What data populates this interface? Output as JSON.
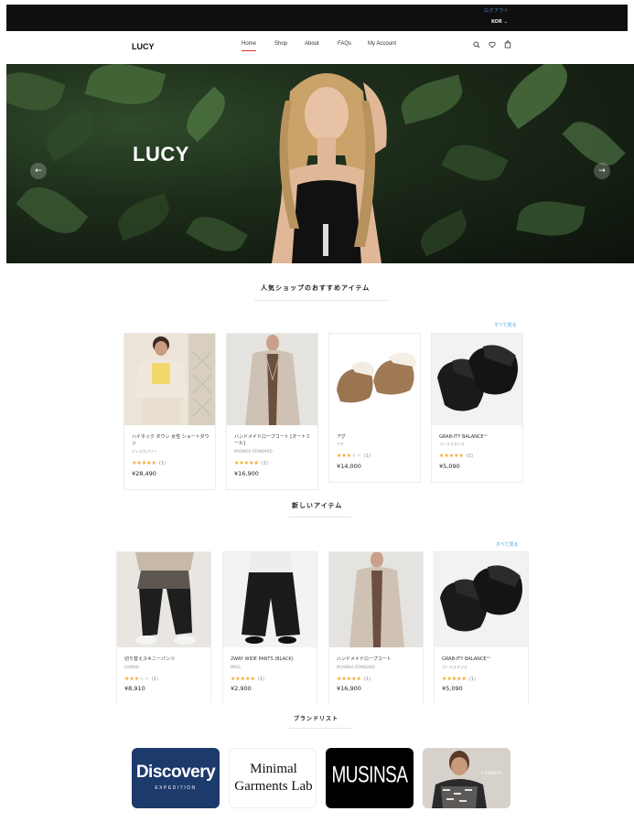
{
  "topbar": {
    "login": "ログアウト",
    "currency": "KOR ⌄"
  },
  "header": {
    "logo": "LUCY",
    "nav": [
      {
        "label": "Home",
        "active": true
      },
      {
        "label": "Shop"
      },
      {
        "label": "About"
      },
      {
        "label": "FAQs"
      },
      {
        "label": "My Account"
      }
    ],
    "icons": [
      "search-icon",
      "heart-icon",
      "bag-icon"
    ]
  },
  "hero": {
    "title": "LUCY",
    "prev": "←",
    "next": "→"
  },
  "popular": {
    "title": "人気ショップのおすすめアイテム",
    "see_all": "すべて見る",
    "items": [
      {
        "name": "ハイネック ダウン 女性 ショートダウン",
        "brand": "ディスカバリー",
        "rating": 5,
        "reviews": "(1)",
        "price": "¥28,490"
      },
      {
        "name": "ハンドメイドロープコート [オートミール]",
        "brand": "MUSINSA STANDARD",
        "rating": 5,
        "reviews": "(1)",
        "price": "¥16,900"
      },
      {
        "name": "アグ",
        "brand": "アグ",
        "rating": 3.5,
        "reviews": "(1)",
        "price": "¥14,000"
      },
      {
        "name": "GRAB-ITY BALANCE™",
        "brand": "ゴールスタジオ",
        "rating": 5,
        "reviews": "(1)",
        "price": "¥5,090"
      }
    ]
  },
  "newitems": {
    "title": "新しいアイテム",
    "see_all": "すべて見る",
    "items": [
      {
        "name": "切り替えスキニーパンツ",
        "brand": "CAMBIO",
        "rating": 3.5,
        "reviews": "(1)",
        "price": "¥8,910"
      },
      {
        "name": "2WAY WIDE PANTS (BLACK)",
        "brand": "MHCL",
        "rating": 5,
        "reviews": "(1)",
        "price": "¥2,900"
      },
      {
        "name": "ハンドメイドロープコート",
        "brand": "MUSINSA STANDARD",
        "rating": 5,
        "reviews": "(1)",
        "price": "¥16,900"
      },
      {
        "name": "GRAB-ITY BALANCE™",
        "brand": "ゴールスタジオ",
        "rating": 5,
        "reviews": "(1)",
        "price": "¥5,090"
      }
    ]
  },
  "brands": {
    "title": "ブランドリスト",
    "items": [
      {
        "name": "Discovery",
        "sub": "EXPEDITION"
      },
      {
        "name": "Minimal",
        "sub": "Garments Lab"
      },
      {
        "name": "MUSINSA"
      },
      {
        "name": "CAMBIO"
      }
    ]
  },
  "colors": {
    "accent": "#4a9fd0",
    "star": "#f5a623",
    "nav_active": "#dd3333",
    "topbar": "#0f0f0f"
  }
}
